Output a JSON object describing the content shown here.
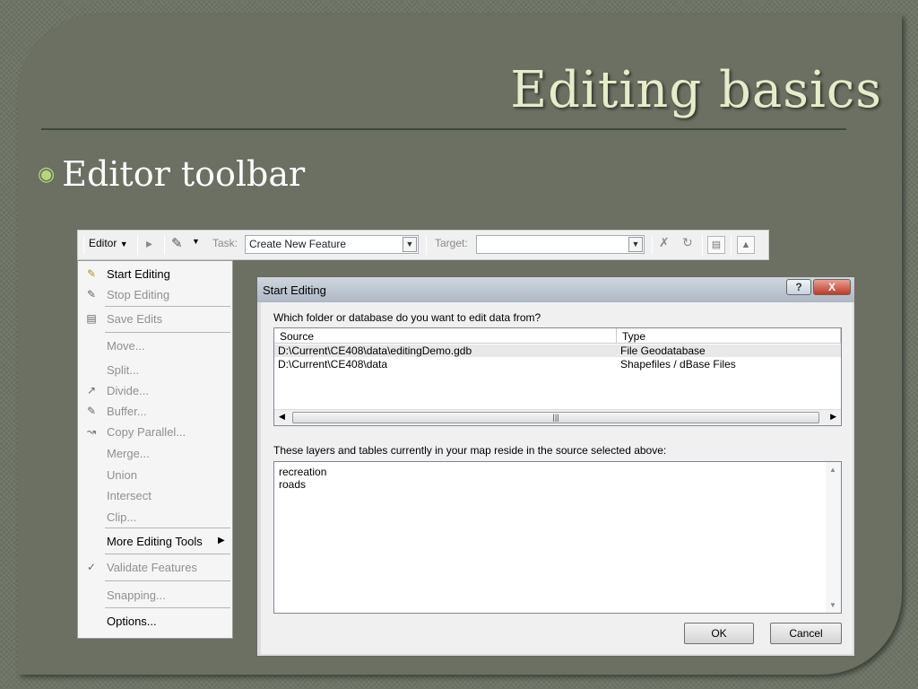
{
  "slide": {
    "title": "Editing basics",
    "bullet": "Editor toolbar"
  },
  "toolbar": {
    "editor_label": "Editor",
    "task_label": "Task:",
    "task_value": "Create New Feature",
    "target_label": "Target:",
    "target_value": "",
    "icons": [
      "select-arrow-icon",
      "sketch-pencil-icon",
      "split-icon",
      "rotate-icon",
      "attributes-icon",
      "sketch-properties-icon"
    ]
  },
  "menu": {
    "items": [
      {
        "label": "Start Editing",
        "enabled": true
      },
      {
        "label": "Stop Editing",
        "enabled": false
      },
      {
        "label": "Save Edits",
        "enabled": false
      },
      {
        "label": "Move...",
        "enabled": false
      },
      {
        "label": "Split...",
        "enabled": false
      },
      {
        "label": "Divide...",
        "enabled": false
      },
      {
        "label": "Buffer...",
        "enabled": false
      },
      {
        "label": "Copy Parallel...",
        "enabled": false
      },
      {
        "label": "Merge...",
        "enabled": false
      },
      {
        "label": "Union",
        "enabled": false
      },
      {
        "label": "Intersect",
        "enabled": false
      },
      {
        "label": "Clip...",
        "enabled": false
      },
      {
        "label": "More Editing Tools",
        "enabled": true
      },
      {
        "label": "Validate Features",
        "enabled": false
      },
      {
        "label": "Snapping...",
        "enabled": false
      },
      {
        "label": "Options...",
        "enabled": true
      }
    ]
  },
  "dialog": {
    "title": "Start Editing",
    "help_label": "?",
    "close_label": "X",
    "prompt": "Which folder or database do you want to edit data from?",
    "columns": [
      "Source",
      "Type"
    ],
    "rows": [
      {
        "source": "D:\\Current\\CE408\\data\\editingDemo.gdb",
        "type": "File Geodatabase"
      },
      {
        "source": "D:\\Current\\CE408\\data",
        "type": "Shapefiles / dBase Files"
      }
    ],
    "layers_prompt": "These layers and tables currently in your map reside in the source selected above:",
    "layers": [
      "recreation",
      "roads"
    ],
    "ok_label": "OK",
    "cancel_label": "Cancel"
  }
}
